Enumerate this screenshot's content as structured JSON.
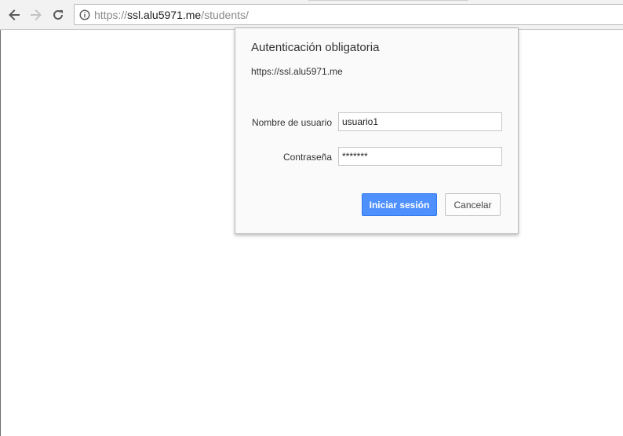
{
  "browser": {
    "url": {
      "scheme": "https://",
      "host": "ssl.alu5971.me",
      "path": "/students/"
    },
    "icons": {
      "back": "arrow-left-icon",
      "forward": "arrow-right-icon",
      "reload": "reload-icon",
      "site_info": "info-icon"
    }
  },
  "auth_dialog": {
    "title": "Autenticación obligatoria",
    "origin": "https://ssl.alu5971.me",
    "username": {
      "label": "Nombre de usuario",
      "value": "usuario1"
    },
    "password": {
      "label": "Contraseña",
      "value": "*******"
    },
    "submit_label": "Iniciar sesión",
    "cancel_label": "Cancelar"
  },
  "colors": {
    "primary_button": "#4d90fe",
    "toolbar": "#f2f2f2",
    "dialog_background": "#fafafa"
  }
}
